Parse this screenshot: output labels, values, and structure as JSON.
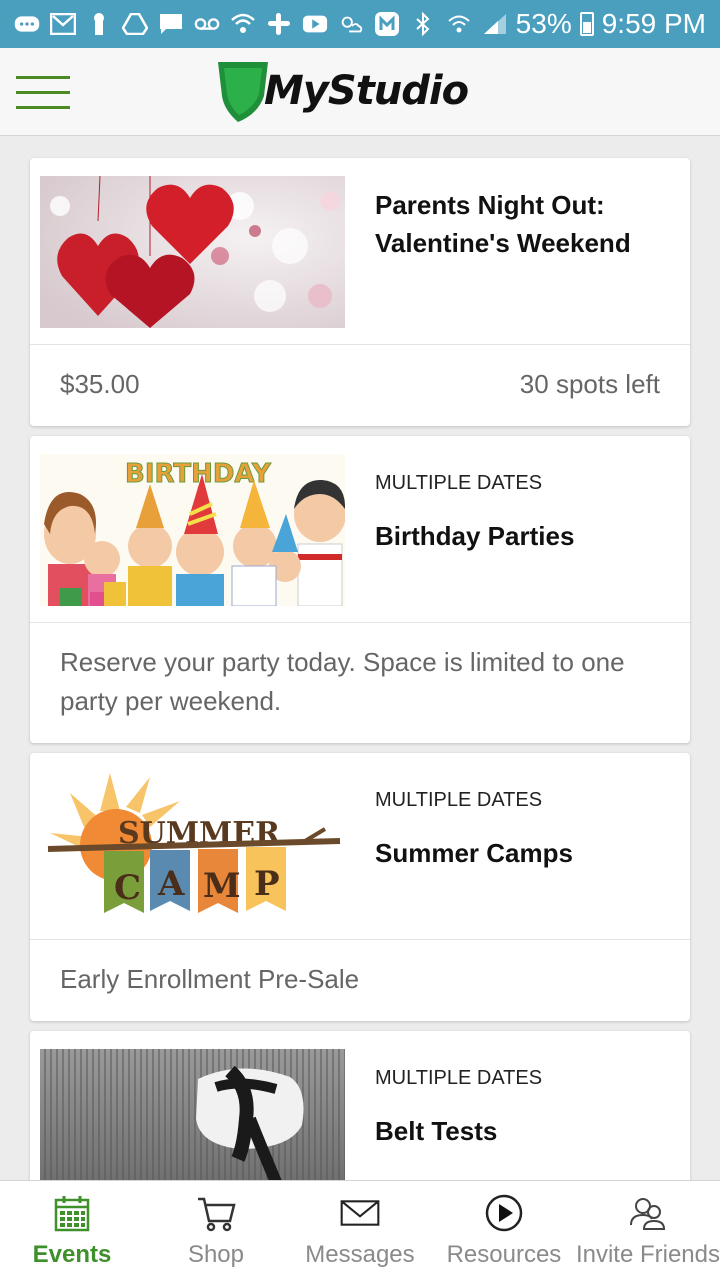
{
  "status_bar": {
    "battery": "53%",
    "time": "9:59 PM",
    "icons": [
      "chat-bubble-icon",
      "gmail-icon",
      "keyhole-icon",
      "drive-icon",
      "message-icon",
      "voicemail-icon",
      "wifi-call-icon",
      "slack-icon",
      "youtube-icon",
      "weather-icon",
      "m-app-icon",
      "bluetooth-icon",
      "wifi-icon",
      "signal-icon"
    ]
  },
  "header": {
    "logo_text": "MyStudio",
    "brand_color": "#3f8f2a"
  },
  "events": [
    {
      "title": "Parents Night Out: Valentine's Weekend",
      "dates": "",
      "price": "$35.00",
      "spots": "30 spots left",
      "description": ""
    },
    {
      "title": "Birthday Parties",
      "dates": "MULTIPLE DATES",
      "description": "Reserve your party today. Space is limited to one party per weekend.",
      "image_text": "BIRTHDAY"
    },
    {
      "title": "Summer Camps",
      "dates": "MULTIPLE DATES",
      "description": "Early Enrollment Pre-Sale",
      "image_text_top": "SUMMER",
      "image_letters": [
        "C",
        "A",
        "M",
        "P"
      ]
    },
    {
      "title": "Belt Tests",
      "dates": "MULTIPLE DATES",
      "description": ""
    }
  ],
  "bottom_nav": [
    {
      "label": "Events",
      "icon": "calendar-icon",
      "active": true
    },
    {
      "label": "Shop",
      "icon": "cart-icon",
      "active": false
    },
    {
      "label": "Messages",
      "icon": "envelope-icon",
      "active": false
    },
    {
      "label": "Resources",
      "icon": "play-circle-icon",
      "active": false
    },
    {
      "label": "Invite Friends",
      "icon": "people-icon",
      "active": false
    }
  ]
}
